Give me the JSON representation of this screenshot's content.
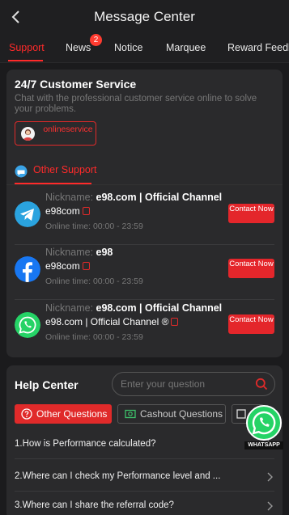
{
  "header": {
    "title": "Message Center"
  },
  "tabs": [
    {
      "label": "Support"
    },
    {
      "label": "News",
      "badge": "2"
    },
    {
      "label": "Notice"
    },
    {
      "label": "Marquee"
    },
    {
      "label": "Reward Feedback"
    }
  ],
  "customer_service": {
    "title": "24/7 Customer Service",
    "description": "Chat with the professional customer service online to solve your problems.",
    "online_label": "onlineservice"
  },
  "other_support": {
    "label": "Other Support",
    "items": [
      {
        "icon": "telegram-icon",
        "nickname_label": "Nickname:",
        "nickname": "e98.com | Official Channel",
        "account": "e98com",
        "online_time": "Online time:  00:00 - 23:59",
        "contact": "Contact Now"
      },
      {
        "icon": "facebook-icon",
        "nickname_label": "Nickname:",
        "nickname": "e98",
        "account": "e98com",
        "online_time": "Online time:  00:00 - 23:59",
        "contact": "Contact Now"
      },
      {
        "icon": "whatsapp-icon",
        "nickname_label": "Nickname:",
        "nickname": "e98.com | Official Channel",
        "account": "e98.com | Official Channel ®",
        "online_time": "Online time:  00:00 - 23:59",
        "contact": "Contact Now"
      }
    ]
  },
  "help_center": {
    "title": "Help Center",
    "search_placeholder": "Enter your question",
    "chips": [
      {
        "label": "Other Questions"
      },
      {
        "label": "Cashout Questions"
      }
    ],
    "faqs": [
      {
        "question": "1.How is Performance calculated?"
      },
      {
        "question": "2.Where can I check my Performance level and ..."
      },
      {
        "question": "3.Where can I share the referral code?"
      }
    ]
  },
  "floating": {
    "label": "WHATSAPP"
  },
  "colors": {
    "accent": "#e4262b",
    "background": "#1b1b1d",
    "card": "#2a2a2c"
  }
}
